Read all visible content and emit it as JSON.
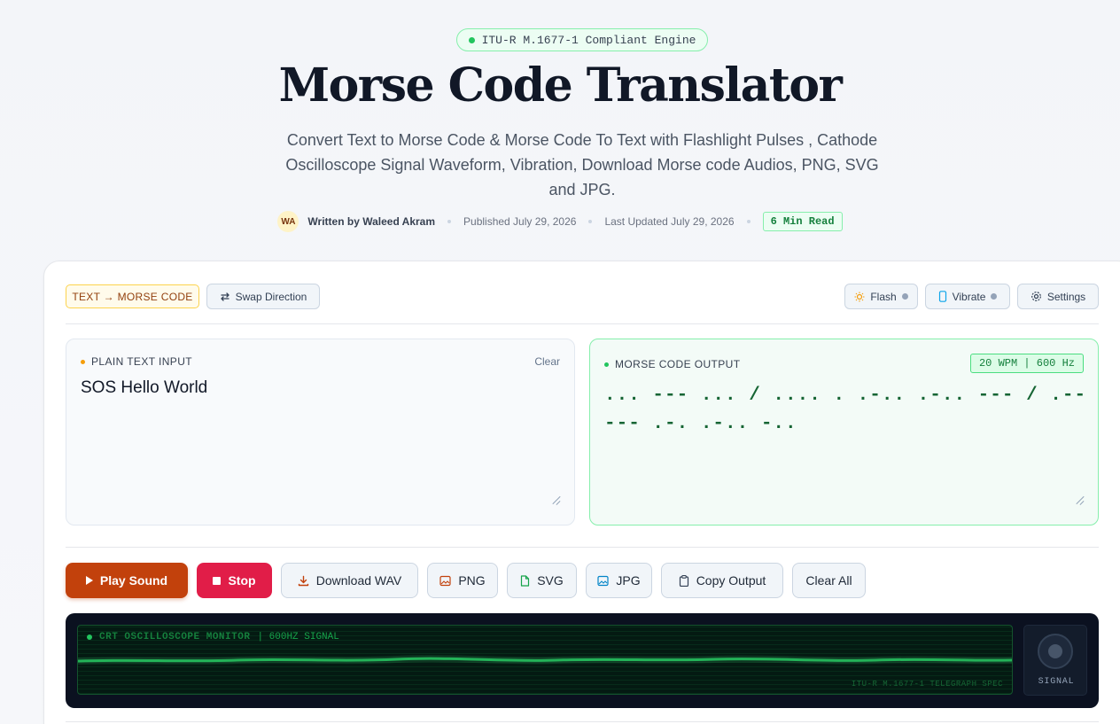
{
  "header": {
    "badge": "ITU-R M.1677-1 Compliant Engine",
    "title": "Morse Code Translator",
    "subtitle": "Convert Text to Morse Code & Morse Code To Text with Flashlight Pulses , Cathode Oscilloscope Signal Waveform, Vibration, Download Morse code Audios, PNG, SVG and JPG.",
    "author_initials": "WA",
    "author": "Written by Waleed Akram",
    "published": "Published July 29, 2026",
    "updated": "Last Updated July 29, 2026",
    "read_time": "6 Min Read"
  },
  "toolbar": {
    "mode": "TEXT → MORSE CODE",
    "swap": "Swap Direction",
    "flash": "Flash",
    "vibrate": "Vibrate",
    "settings": "Settings"
  },
  "input_panel": {
    "label": "PLAIN TEXT INPUT",
    "clear": "Clear",
    "value": "SOS Hello World"
  },
  "output_panel": {
    "label": "MORSE CODE OUTPUT",
    "speed": "20 WPM | 600 Hz",
    "value": "... --- ... / .... . .-.. .-.. --- / .-- --- .-. .-.. -.."
  },
  "actions": {
    "play": "Play Sound",
    "stop": "Stop",
    "download_wav": "Download WAV",
    "png": "PNG",
    "svg": "SVG",
    "jpg": "JPG",
    "copy": "Copy Output",
    "clear_all": "Clear All"
  },
  "scope": {
    "title": "CRT OSCILLOSCOPE MONITOR",
    "freq": "| 600HZ SIGNAL",
    "footer": "ITU-R M.1677-1 TELEGRAPH SPEC",
    "signal": "SIGNAL"
  },
  "colors": {
    "accent_orange": "#c2410c",
    "stop_red": "#e11d48",
    "morse_green": "#166534",
    "scope_trace": "#22c55e"
  }
}
